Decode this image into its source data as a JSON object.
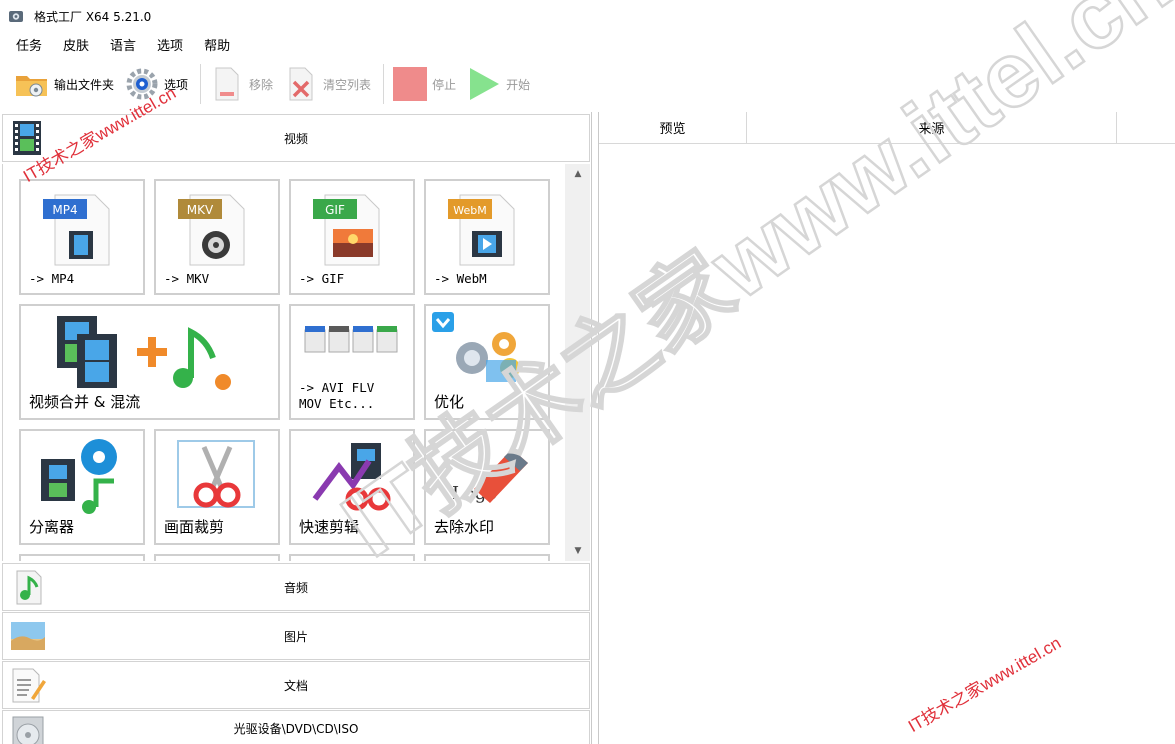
{
  "window": {
    "title": "格式工厂 X64 5.21.0"
  },
  "menu": [
    "任务",
    "皮肤",
    "语言",
    "选项",
    "帮助"
  ],
  "toolbar": {
    "output_folder": "输出文件夹",
    "options": "选项",
    "remove": "移除",
    "clear_list": "清空列表",
    "stop": "停止",
    "start": "开始"
  },
  "categories": {
    "video": "视频",
    "audio": "音频",
    "image": "图片",
    "document": "文档",
    "disc": "光驱设备\\DVD\\CD\\ISO"
  },
  "tiles": {
    "mp4": {
      "badge": "MP4",
      "label": "-> MP4"
    },
    "mkv": {
      "badge": "MKV",
      "label": "-> MKV"
    },
    "gif": {
      "badge": "GIF",
      "label": "-> GIF"
    },
    "webm": {
      "badge": "WebM",
      "label": "-> WebM"
    },
    "merge": {
      "label": "视频合并 & 混流"
    },
    "avi": {
      "label": "-> AVI FLV\nMOV Etc..."
    },
    "optimize": {
      "label": "优化"
    },
    "splitter": {
      "label": "分离器"
    },
    "crop": {
      "label": "画面裁剪"
    },
    "quick_edit": {
      "label": "快速剪辑"
    },
    "remove_watermark": {
      "label": "去除水印",
      "logo_text": "Logo"
    }
  },
  "task_list": {
    "columns": [
      "预览",
      "来源"
    ]
  },
  "watermarks": {
    "text": "IT技术之家www.ittel.cn"
  },
  "colors": {
    "watermark": "#e0303a",
    "border": "#cfcfcf",
    "start_green": "#3cc84a",
    "stop_red": "#ef8b8b"
  }
}
